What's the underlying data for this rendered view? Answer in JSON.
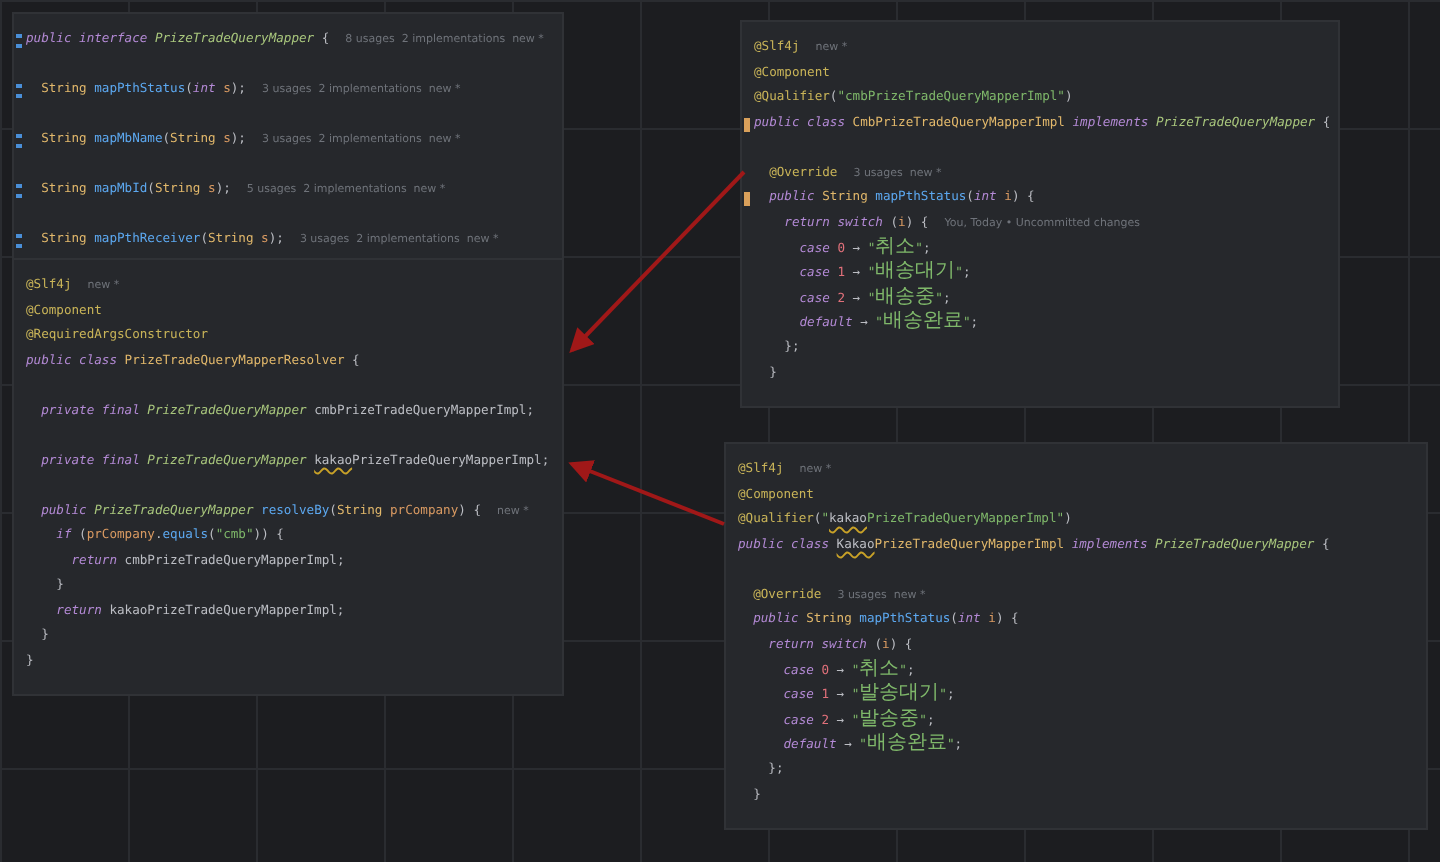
{
  "panels": [
    {
      "lines": [
        {
          "kind": "code",
          "implemented_marker": true,
          "code": [
            {
              "kind": "keyword",
              "text": "public interface "
            },
            {
              "kind": "class",
              "text": "PrizeTradeQueryMapper"
            },
            {
              "kind": "plain",
              "text": " {"
            }
          ],
          "hint": "8 usages  2 implementations  new *"
        },
        {
          "kind": "blank"
        },
        {
          "kind": "code",
          "implemented_marker": true,
          "code": [
            {
              "kind": "type",
              "text": "  String "
            },
            {
              "kind": "method",
              "text": "mapPthStatus"
            },
            {
              "kind": "plain",
              "text": "("
            },
            {
              "kind": "keyword",
              "text": "int "
            },
            {
              "kind": "param",
              "text": "s"
            },
            {
              "kind": "plain",
              "text": ");"
            }
          ],
          "hint": "3 usages  2 implementations  new *"
        },
        {
          "kind": "blank"
        },
        {
          "kind": "code",
          "implemented_marker": true,
          "code": [
            {
              "kind": "type",
              "text": "  String "
            },
            {
              "kind": "method",
              "text": "mapMbName"
            },
            {
              "kind": "plain",
              "text": "("
            },
            {
              "kind": "type",
              "text": "String "
            },
            {
              "kind": "param",
              "text": "s"
            },
            {
              "kind": "plain",
              "text": ");"
            }
          ],
          "hint": "3 usages  2 implementations  new *"
        },
        {
          "kind": "blank"
        },
        {
          "kind": "code",
          "implemented_marker": true,
          "code": [
            {
              "kind": "type",
              "text": "  String "
            },
            {
              "kind": "method",
              "text": "mapMbId"
            },
            {
              "kind": "plain",
              "text": "("
            },
            {
              "kind": "type",
              "text": "String "
            },
            {
              "kind": "param",
              "text": "s"
            },
            {
              "kind": "plain",
              "text": ");"
            }
          ],
          "hint": "5 usages  2 implementations  new *"
        },
        {
          "kind": "blank"
        },
        {
          "kind": "code",
          "implemented_marker": true,
          "code": [
            {
              "kind": "type",
              "text": "  String "
            },
            {
              "kind": "method",
              "text": "mapPthReceiver"
            },
            {
              "kind": "plain",
              "text": "("
            },
            {
              "kind": "type",
              "text": "String "
            },
            {
              "kind": "param",
              "text": "s"
            },
            {
              "kind": "plain",
              "text": ");"
            }
          ],
          "hint": "3 usages  2 implementations  new *"
        }
      ]
    },
    {
      "lines": [
        {
          "kind": "code",
          "code": [
            {
              "kind": "annotation",
              "text": "@Slf4j"
            }
          ],
          "hint": "new *"
        },
        {
          "kind": "code",
          "code": [
            {
              "kind": "annotation",
              "text": "@Component"
            }
          ]
        },
        {
          "kind": "code",
          "code": [
            {
              "kind": "annotation",
              "text": "@RequiredArgsConstructor"
            }
          ]
        },
        {
          "kind": "code",
          "code": [
            {
              "kind": "keyword",
              "text": "public class "
            },
            {
              "kind": "type",
              "text": "PrizeTradeQueryMapperResolver"
            },
            {
              "kind": "plain",
              "text": " {"
            }
          ]
        },
        {
          "kind": "blank"
        },
        {
          "kind": "code",
          "code": [
            {
              "kind": "keyword",
              "text": "  private final "
            },
            {
              "kind": "class",
              "text": "PrizeTradeQueryMapper "
            },
            {
              "kind": "plain",
              "text": "cmbPrizeTradeQueryMapperImpl;"
            }
          ]
        },
        {
          "kind": "blank"
        },
        {
          "kind": "code",
          "code": [
            {
              "kind": "keyword",
              "text": "  private final "
            },
            {
              "kind": "class",
              "text": "PrizeTradeQueryMapper "
            },
            {
              "kind": "typo",
              "text": "kakao"
            },
            {
              "kind": "plain",
              "text": "PrizeTradeQueryMapperImpl;"
            }
          ]
        },
        {
          "kind": "blank"
        },
        {
          "kind": "code",
          "code": [
            {
              "kind": "keyword",
              "text": "  public "
            },
            {
              "kind": "class",
              "text": "PrizeTradeQueryMapper "
            },
            {
              "kind": "method",
              "text": "resolveBy"
            },
            {
              "kind": "plain",
              "text": "("
            },
            {
              "kind": "type",
              "text": "String "
            },
            {
              "kind": "param",
              "text": "prCompany"
            },
            {
              "kind": "plain",
              "text": ") {"
            }
          ],
          "hint": "new *"
        },
        {
          "kind": "code",
          "code": [
            {
              "kind": "keyword",
              "text": "    if "
            },
            {
              "kind": "plain",
              "text": "("
            },
            {
              "kind": "param",
              "text": "prCompany"
            },
            {
              "kind": "plain",
              "text": "."
            },
            {
              "kind": "method",
              "text": "equals"
            },
            {
              "kind": "plain",
              "text": "("
            },
            {
              "kind": "string",
              "text": "\"cmb\""
            },
            {
              "kind": "plain",
              "text": ")) {"
            }
          ]
        },
        {
          "kind": "code",
          "code": [
            {
              "kind": "keyword",
              "text": "      return "
            },
            {
              "kind": "plain",
              "text": "cmbPrizeTradeQueryMapperImpl;"
            }
          ]
        },
        {
          "kind": "code",
          "code": [
            {
              "kind": "plain",
              "text": "    }"
            }
          ]
        },
        {
          "kind": "code",
          "code": [
            {
              "kind": "keyword",
              "text": "    return "
            },
            {
              "kind": "plain",
              "text": "kakaoPrizeTradeQueryMapperImpl;"
            }
          ]
        },
        {
          "kind": "code",
          "code": [
            {
              "kind": "plain",
              "text": "  }"
            }
          ]
        },
        {
          "kind": "code",
          "code": [
            {
              "kind": "plain",
              "text": "}"
            }
          ]
        }
      ]
    },
    {
      "lines": [
        {
          "kind": "code",
          "code": [
            {
              "kind": "annotation",
              "text": "@Slf4j"
            }
          ],
          "hint": "new *"
        },
        {
          "kind": "code",
          "code": [
            {
              "kind": "annotation",
              "text": "@Component"
            }
          ]
        },
        {
          "kind": "code",
          "code": [
            {
              "kind": "annotation",
              "text": "@Qualifier"
            },
            {
              "kind": "plain",
              "text": "("
            },
            {
              "kind": "string",
              "text": "\"cmbPrizeTradeQueryMapperImpl\""
            },
            {
              "kind": "plain",
              "text": ")"
            }
          ]
        },
        {
          "kind": "code",
          "implements_marker": true,
          "code": [
            {
              "kind": "keyword",
              "text": "public class "
            },
            {
              "kind": "type",
              "text": "CmbPrizeTradeQueryMapperImpl "
            },
            {
              "kind": "keyword",
              "text": "implements "
            },
            {
              "kind": "class",
              "text": "PrizeTradeQueryMapper"
            },
            {
              "kind": "plain",
              "text": " {"
            }
          ]
        },
        {
          "kind": "blank"
        },
        {
          "kind": "code",
          "code": [
            {
              "kind": "annotation",
              "text": "  @Override"
            }
          ],
          "hint": "3 usages  new *"
        },
        {
          "kind": "code",
          "implements_marker": true,
          "code": [
            {
              "kind": "keyword",
              "text": "  public "
            },
            {
              "kind": "type",
              "text": "String "
            },
            {
              "kind": "method",
              "text": "mapPthStatus"
            },
            {
              "kind": "plain",
              "text": "("
            },
            {
              "kind": "keyword",
              "text": "int "
            },
            {
              "kind": "param",
              "text": "i"
            },
            {
              "kind": "plain",
              "text": ") {"
            }
          ]
        },
        {
          "kind": "code",
          "code": [
            {
              "kind": "keyword",
              "text": "    return switch "
            },
            {
              "kind": "plain",
              "text": "("
            },
            {
              "kind": "param",
              "text": "i"
            },
            {
              "kind": "plain",
              "text": ") {"
            }
          ],
          "hint": "You, Today • Uncommitted changes"
        },
        {
          "kind": "code",
          "code": [
            {
              "kind": "keyword",
              "text": "      case "
            },
            {
              "kind": "number",
              "text": "0"
            },
            {
              "kind": "plain",
              "text": " → "
            },
            {
              "kind": "string",
              "text": "\"취소\""
            },
            {
              "kind": "plain",
              "text": ";"
            }
          ]
        },
        {
          "kind": "code",
          "code": [
            {
              "kind": "keyword",
              "text": "      case "
            },
            {
              "kind": "number",
              "text": "1"
            },
            {
              "kind": "plain",
              "text": " → "
            },
            {
              "kind": "string",
              "text": "\"배송대기\""
            },
            {
              "kind": "plain",
              "text": ";"
            }
          ]
        },
        {
          "kind": "code",
          "code": [
            {
              "kind": "keyword",
              "text": "      case "
            },
            {
              "kind": "number",
              "text": "2"
            },
            {
              "kind": "plain",
              "text": " → "
            },
            {
              "kind": "string",
              "text": "\"배송중\""
            },
            {
              "kind": "plain",
              "text": ";"
            }
          ]
        },
        {
          "kind": "code",
          "code": [
            {
              "kind": "keyword",
              "text": "      default"
            },
            {
              "kind": "plain",
              "text": " → "
            },
            {
              "kind": "string",
              "text": "\"배송완료\""
            },
            {
              "kind": "plain",
              "text": ";"
            }
          ]
        },
        {
          "kind": "code",
          "code": [
            {
              "kind": "plain",
              "text": "    };"
            }
          ]
        },
        {
          "kind": "code",
          "code": [
            {
              "kind": "plain",
              "text": "  }"
            }
          ]
        }
      ]
    },
    {
      "lines": [
        {
          "kind": "code",
          "code": [
            {
              "kind": "annotation",
              "text": "@Slf4j"
            }
          ],
          "hint": "new *"
        },
        {
          "kind": "code",
          "code": [
            {
              "kind": "annotation",
              "text": "@Component"
            }
          ]
        },
        {
          "kind": "code",
          "code": [
            {
              "kind": "annotation",
              "text": "@Qualifier"
            },
            {
              "kind": "plain",
              "text": "("
            },
            {
              "kind": "string",
              "text": "\""
            },
            {
              "kind": "typo",
              "text": "kakao"
            },
            {
              "kind": "string",
              "text": "PrizeTradeQueryMapperImpl\""
            },
            {
              "kind": "plain",
              "text": ")"
            }
          ]
        },
        {
          "kind": "code",
          "code": [
            {
              "kind": "keyword",
              "text": "public class "
            },
            {
              "kind": "typo",
              "text": "Kakao"
            },
            {
              "kind": "type",
              "text": "PrizeTradeQueryMapperImpl "
            },
            {
              "kind": "keyword",
              "text": "implements "
            },
            {
              "kind": "class",
              "text": "PrizeTradeQueryMapper"
            },
            {
              "kind": "plain",
              "text": " {"
            }
          ]
        },
        {
          "kind": "blank"
        },
        {
          "kind": "code",
          "code": [
            {
              "kind": "annotation",
              "text": "  @Override"
            }
          ],
          "hint": "3 usages  new *"
        },
        {
          "kind": "code",
          "code": [
            {
              "kind": "keyword",
              "text": "  public "
            },
            {
              "kind": "type",
              "text": "String "
            },
            {
              "kind": "method",
              "text": "mapPthStatus"
            },
            {
              "kind": "plain",
              "text": "("
            },
            {
              "kind": "keyword",
              "text": "int "
            },
            {
              "kind": "param",
              "text": "i"
            },
            {
              "kind": "plain",
              "text": ") {"
            }
          ]
        },
        {
          "kind": "code",
          "code": [
            {
              "kind": "keyword",
              "text": "    return switch "
            },
            {
              "kind": "plain",
              "text": "("
            },
            {
              "kind": "param",
              "text": "i"
            },
            {
              "kind": "plain",
              "text": ") {"
            }
          ]
        },
        {
          "kind": "code",
          "code": [
            {
              "kind": "keyword",
              "text": "      case "
            },
            {
              "kind": "number",
              "text": "0"
            },
            {
              "kind": "plain",
              "text": " → "
            },
            {
              "kind": "string",
              "text": "\"취소\""
            },
            {
              "kind": "plain",
              "text": ";"
            }
          ]
        },
        {
          "kind": "code",
          "code": [
            {
              "kind": "keyword",
              "text": "      case "
            },
            {
              "kind": "number",
              "text": "1"
            },
            {
              "kind": "plain",
              "text": " → "
            },
            {
              "kind": "string",
              "text": "\"발송대기\""
            },
            {
              "kind": "plain",
              "text": ";"
            }
          ]
        },
        {
          "kind": "code",
          "code": [
            {
              "kind": "keyword",
              "text": "      case "
            },
            {
              "kind": "number",
              "text": "2"
            },
            {
              "kind": "plain",
              "text": " → "
            },
            {
              "kind": "string",
              "text": "\"발송중\""
            },
            {
              "kind": "plain",
              "text": ";"
            }
          ]
        },
        {
          "kind": "code",
          "code": [
            {
              "kind": "keyword",
              "text": "      default"
            },
            {
              "kind": "plain",
              "text": " → "
            },
            {
              "kind": "string",
              "text": "\"배송완료\""
            },
            {
              "kind": "plain",
              "text": ";"
            }
          ]
        },
        {
          "kind": "code",
          "code": [
            {
              "kind": "plain",
              "text": "    };"
            }
          ]
        },
        {
          "kind": "code",
          "code": [
            {
              "kind": "plain",
              "text": "  }"
            }
          ]
        }
      ]
    }
  ]
}
